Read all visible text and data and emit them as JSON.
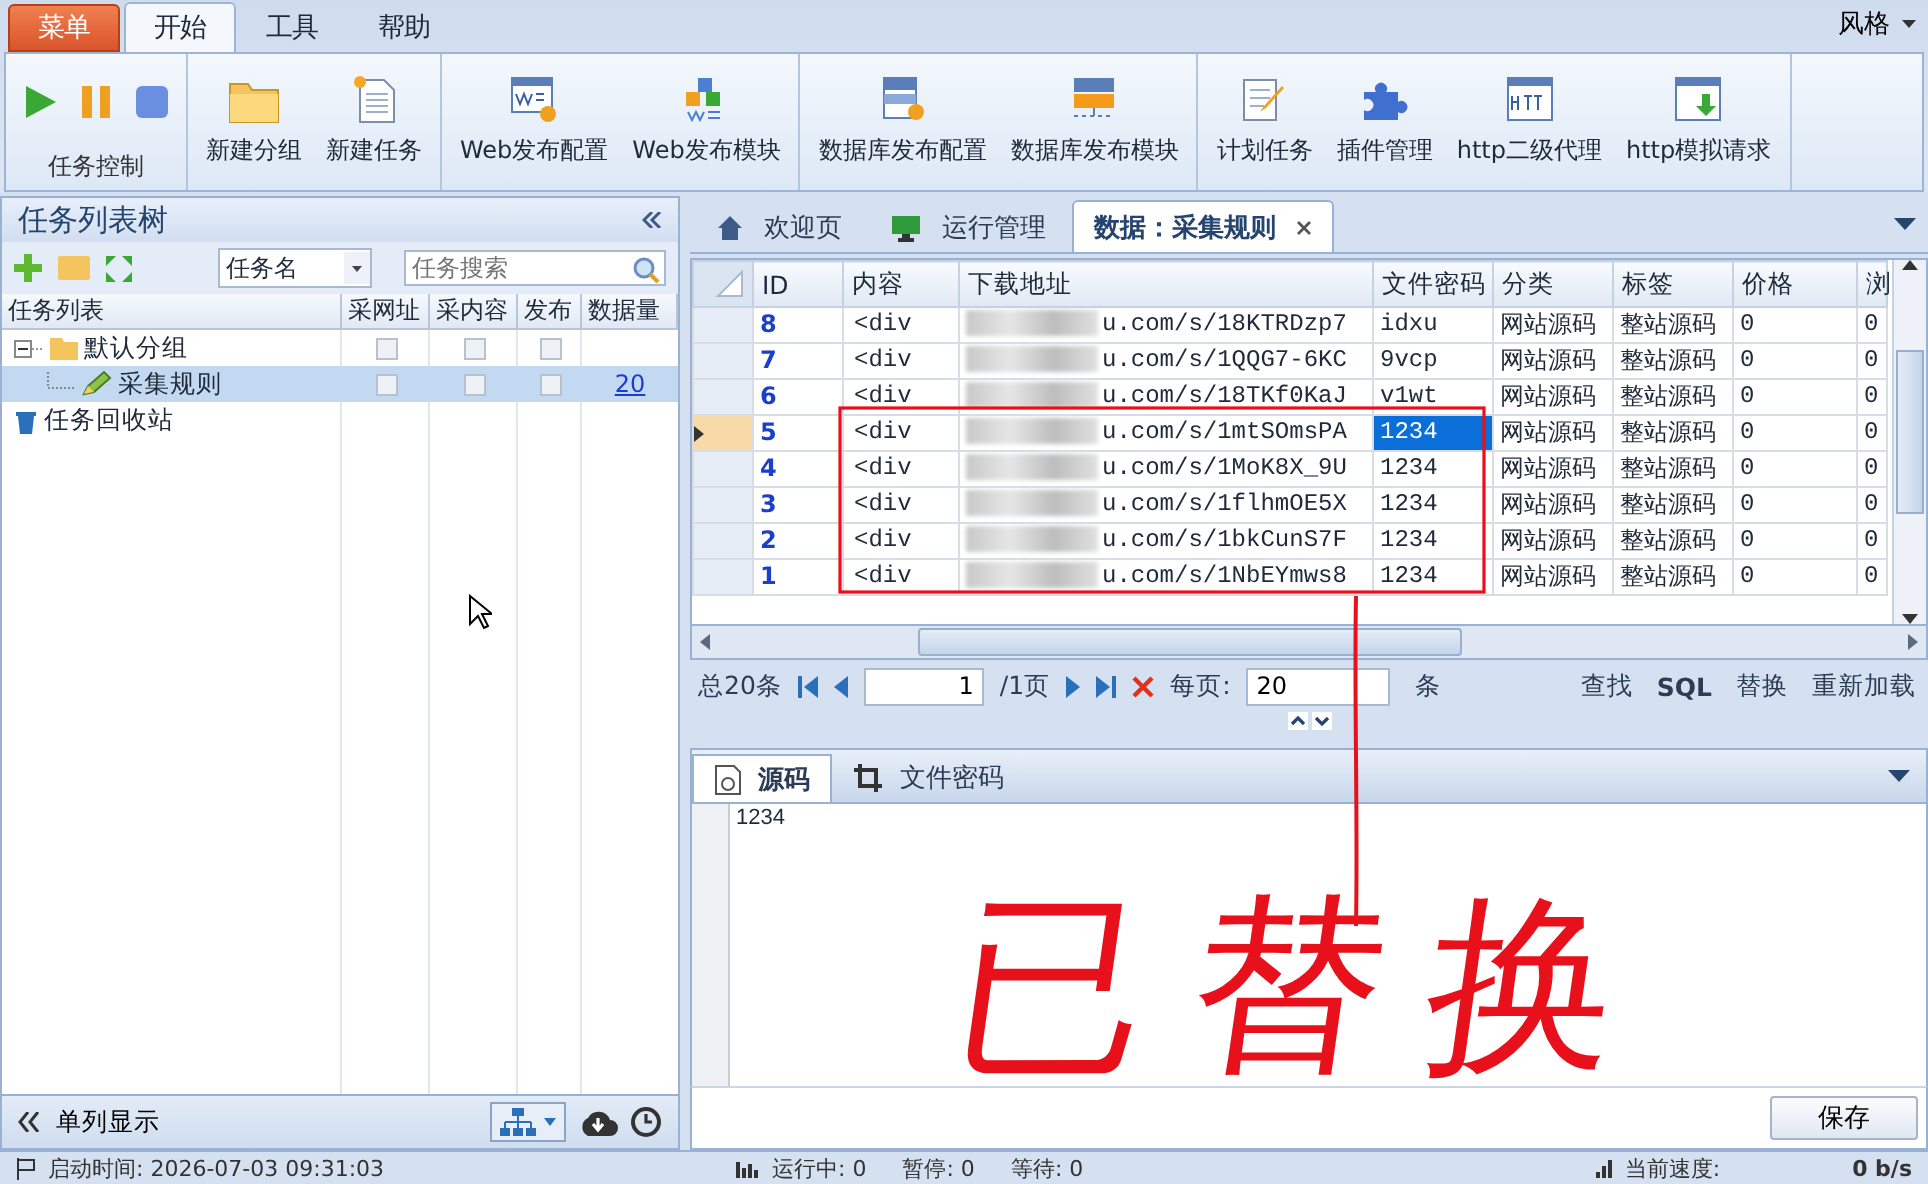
{
  "app_menu": "菜单",
  "ribbon_tabs": [
    {
      "label": "开始",
      "selected": true
    },
    {
      "label": "工具",
      "selected": false
    },
    {
      "label": "帮助",
      "selected": false
    }
  ],
  "style_menu": "风格",
  "ribbon_groups": [
    {
      "label": "任务控制",
      "buttons": [
        {
          "kind": "play"
        },
        {
          "kind": "pause"
        },
        {
          "kind": "stop"
        }
      ]
    },
    {
      "buttons": [
        {
          "kind": "folder",
          "label": "新建分组"
        },
        {
          "kind": "newdoc",
          "label": "新建任务"
        }
      ]
    },
    {
      "buttons": [
        {
          "kind": "webcfg",
          "label": "Web发布配置"
        },
        {
          "kind": "webmod",
          "label": "Web发布模块"
        }
      ]
    },
    {
      "buttons": [
        {
          "kind": "dbcfg",
          "label": "数据库发布配置"
        },
        {
          "kind": "dbmod",
          "label": "数据库发布模块"
        }
      ]
    },
    {
      "buttons": [
        {
          "kind": "plan",
          "label": "计划任务"
        },
        {
          "kind": "plugin",
          "label": "插件管理"
        },
        {
          "kind": "http",
          "label": "http二级代理"
        },
        {
          "kind": "httpdl",
          "label": "http模拟请求"
        }
      ]
    }
  ],
  "tree_panel": {
    "title": "任务列表树",
    "filter": "任务名",
    "search": {
      "placeholder": "任务搜索"
    },
    "columns": [
      "任务列表",
      "采网址",
      "采内容",
      "发布",
      "数据量"
    ],
    "nodes": [
      {
        "kind": "folder",
        "label": "默认分组",
        "expanded": true,
        "selected": false,
        "checks": [
          false,
          false,
          false
        ],
        "children": [
          {
            "kind": "task",
            "label": "采集规则",
            "selected": true,
            "checks": [
              false,
              false,
              false
            ],
            "count": "20"
          }
        ]
      },
      {
        "kind": "trash",
        "label": "任务回收站",
        "selected": false
      }
    ],
    "footer": "单列显示"
  },
  "doc_tabs": [
    {
      "kind": "home",
      "label": "欢迎页",
      "selected": false
    },
    {
      "kind": "monitor",
      "label": "运行管理",
      "selected": false
    },
    {
      "kind": "data",
      "label": "数据：采集规则",
      "selected": true
    }
  ],
  "table": {
    "columns": [
      "ID",
      "内容",
      "下载地址",
      "文件密码",
      "分类",
      "标签",
      "价格",
      "浏"
    ],
    "rows": [
      {
        "id": "8",
        "content": "<div",
        "url": "u.com/s/18KTRDzp7",
        "password": "idxu",
        "category": "网站源码",
        "tag": "整站源码",
        "price": "0",
        "column_8": "0",
        "selected": false
      },
      {
        "id": "7",
        "content": "<div",
        "url": "u.com/s/1QQG7-6KC",
        "password": "9vcp",
        "category": "网站源码",
        "tag": "整站源码",
        "price": "0",
        "column_8": "0",
        "selected": false
      },
      {
        "id": "6",
        "content": "<div",
        "url": "u.com/s/18TKf0KaJ",
        "password": "v1wt",
        "category": "网站源码",
        "tag": "整站源码",
        "price": "0",
        "column_8": "0",
        "selected": false
      },
      {
        "id": "5",
        "content": "<div",
        "url": "u.com/s/1mtSOmsPA",
        "password": "1234",
        "category": "网站源码",
        "tag": "整站源码",
        "price": "0",
        "column_8": "0",
        "selected": true
      },
      {
        "id": "4",
        "content": "<div",
        "url": "u.com/s/1MoK8X_9U",
        "password": "1234",
        "category": "网站源码",
        "tag": "整站源码",
        "price": "0",
        "column_8": "0",
        "selected": false
      },
      {
        "id": "3",
        "content": "<div",
        "url": "u.com/s/1flhmOE5X",
        "password": "1234",
        "category": "网站源码",
        "tag": "整站源码",
        "price": "0",
        "column_8": "0",
        "selected": false
      },
      {
        "id": "2",
        "content": "<div",
        "url": "u.com/s/1bkCunS7F",
        "password": "1234",
        "category": "网站源码",
        "tag": "整站源码",
        "price": "0",
        "column_8": "0",
        "selected": false
      },
      {
        "id": "1",
        "content": "<div",
        "url": "u.com/s/1NbEYmws8",
        "password": "1234",
        "category": "网站源码",
        "tag": "整站源码",
        "price": "0",
        "column_8": "0",
        "selected": false
      }
    ]
  },
  "pager": {
    "total": "总20条",
    "page": "1",
    "pages": "/1页",
    "per_page_label": "每页:",
    "per_page": "20",
    "unit": "条",
    "actions": [
      "查找",
      "SQL",
      "替换",
      "重新加载"
    ]
  },
  "detail_tabs": [
    {
      "kind": "source",
      "label": "源码",
      "selected": true
    },
    {
      "kind": "crop",
      "label": "文件密码",
      "selected": false
    }
  ],
  "editor_text": "1234",
  "save_button": "保存",
  "annotation": "已替换",
  "status_bar": [
    "启动时间: 2026-07-03 09:31:03",
    "运行中: 0",
    "暂停: 0",
    "等待: 0",
    "当前速度:",
    "0 b/s"
  ]
}
